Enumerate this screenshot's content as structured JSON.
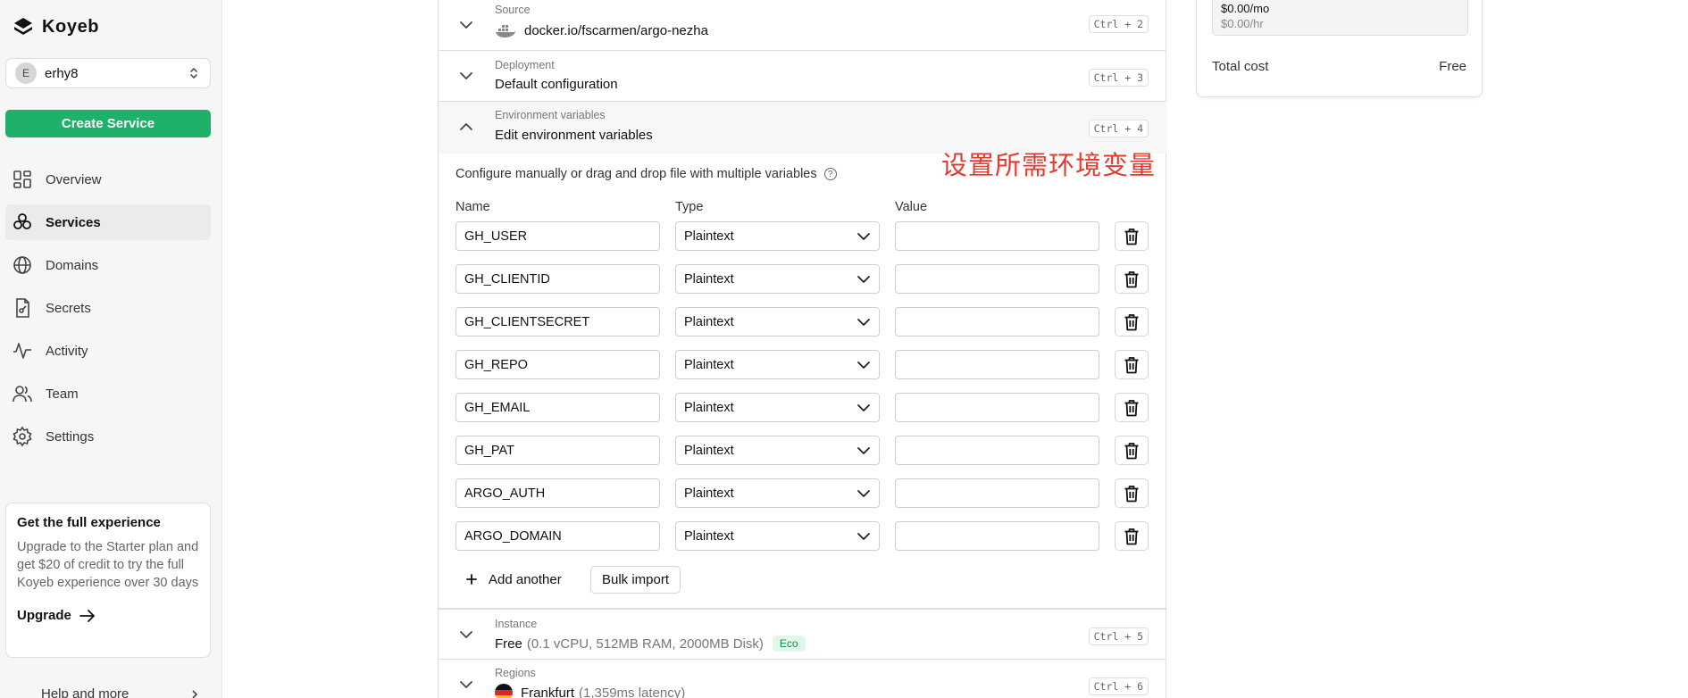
{
  "app": {
    "name": "Koyeb"
  },
  "org": {
    "initial": "E",
    "name": "erhy8"
  },
  "sidebar": {
    "create_label": "Create Service",
    "items": [
      {
        "label": "Overview",
        "icon": "grid-icon"
      },
      {
        "label": "Services",
        "icon": "services-icon",
        "active": true
      },
      {
        "label": "Domains",
        "icon": "globe-icon"
      },
      {
        "label": "Secrets",
        "icon": "secret-file-icon"
      },
      {
        "label": "Activity",
        "icon": "activity-icon"
      },
      {
        "label": "Team",
        "icon": "team-icon"
      },
      {
        "label": "Settings",
        "icon": "gear-icon"
      }
    ],
    "promo": {
      "title": "Get the full experience",
      "text": "Upgrade to the Starter plan and get $20 of credit to try the full Koyeb experience over 30 days",
      "link": "Upgrade"
    },
    "help_label": "Help and more"
  },
  "sections": {
    "source": {
      "label": "Source",
      "value": "docker.io/fscarmen/argo-nezha",
      "shortcut": "Ctrl + 2"
    },
    "deployment": {
      "label": "Deployment",
      "value": "Default configuration",
      "shortcut": "Ctrl + 3"
    },
    "env": {
      "label": "Environment variables",
      "value": "Edit environment variables",
      "shortcut": "Ctrl + 4",
      "intro": "Configure manually or drag and drop file with multiple variables",
      "annotation": "设置所需环境变量",
      "columns": {
        "name": "Name",
        "type": "Type",
        "value": "Value"
      },
      "rows": [
        {
          "name": "GH_USER",
          "type": "Plaintext",
          "value": ""
        },
        {
          "name": "GH_CLIENTID",
          "type": "Plaintext",
          "value": ""
        },
        {
          "name": "GH_CLIENTSECRET",
          "type": "Plaintext",
          "value": ""
        },
        {
          "name": "GH_REPO",
          "type": "Plaintext",
          "value": ""
        },
        {
          "name": "GH_EMAIL",
          "type": "Plaintext",
          "value": ""
        },
        {
          "name": "GH_PAT",
          "type": "Plaintext",
          "value": ""
        },
        {
          "name": "ARGO_AUTH",
          "type": "Plaintext",
          "value": ""
        },
        {
          "name": "ARGO_DOMAIN",
          "type": "Plaintext",
          "value": ""
        }
      ],
      "add_label": "Add another",
      "bulk_label": "Bulk import"
    },
    "instance": {
      "label": "Instance",
      "value": "Free",
      "detail": "(0.1 vCPU, 512MB RAM, 2000MB Disk)",
      "badge": "Eco",
      "shortcut": "Ctrl + 5"
    },
    "regions": {
      "label": "Regions",
      "value": "Frankfurt",
      "detail": "(1,359ms latency)",
      "shortcut": "Ctrl + 6"
    }
  },
  "summary": {
    "price_mo": "$0.00/mo",
    "price_hr": "$0.00/hr",
    "total_label": "Total cost",
    "total_value": "Free"
  },
  "colors": {
    "brand_green": "#1fb06a",
    "annotation_red": "#e53a2f",
    "eco_bg": "#e2f6ea",
    "eco_text": "#188a4c"
  }
}
